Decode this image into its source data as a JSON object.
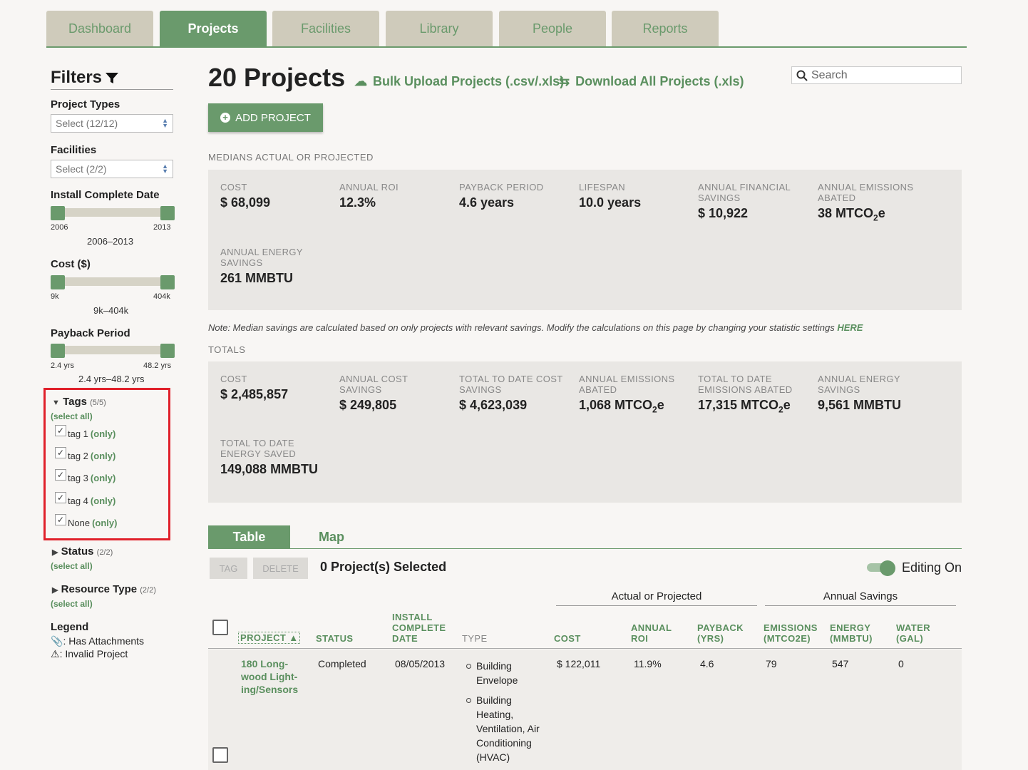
{
  "nav": {
    "tabs": [
      {
        "label": "Dashboard",
        "active": false
      },
      {
        "label": "Projects",
        "active": true
      },
      {
        "label": "Facilities",
        "active": false
      },
      {
        "label": "Library",
        "active": false
      },
      {
        "label": "People",
        "active": false
      },
      {
        "label": "Reports",
        "active": false
      }
    ]
  },
  "filters": {
    "title": "Filters",
    "project_types": {
      "label": "Project Types",
      "value": "Select (12/12)"
    },
    "facilities": {
      "label": "Facilities",
      "value": "Select (2/2)"
    },
    "install_date": {
      "label": "Install Complete Date",
      "min": "2006",
      "max": "2013",
      "range": "2006–2013"
    },
    "cost": {
      "label": "Cost ($)",
      "min": "9k",
      "max": "404k",
      "range": "9k–404k"
    },
    "payback": {
      "label": "Payback Period",
      "min": "2.4 yrs",
      "max": "48.2 yrs",
      "range": "2.4 yrs–48.2 yrs"
    },
    "tags": {
      "label": "Tags",
      "count": "(5/5)",
      "select_all": "(select all)",
      "items": [
        {
          "label": "tag 1",
          "only": "(only)",
          "checked": true
        },
        {
          "label": "tag 2",
          "only": "(only)",
          "checked": true
        },
        {
          "label": "tag 3",
          "only": "(only)",
          "checked": true
        },
        {
          "label": "tag 4",
          "only": "(only)",
          "checked": true
        },
        {
          "label": "None",
          "only": "(only)",
          "checked": true
        }
      ]
    },
    "status": {
      "label": "Status",
      "count": "(2/2)",
      "select_all": "(select all)"
    },
    "resource_type": {
      "label": "Resource Type",
      "count": "(2/2)",
      "select_all": "(select all)"
    },
    "legend": {
      "title": "Legend",
      "attachments": ": Has Attachments",
      "invalid": ": Invalid Project"
    }
  },
  "header": {
    "title": "20 Projects",
    "bulk_upload": "Bulk Upload Projects (.csv/.xls)",
    "download": "Download All Projects (.xls)",
    "search_placeholder": "Search",
    "add_project": "ADD PROJECT"
  },
  "medians": {
    "heading": "MEDIANS ACTUAL OR PROJECTED",
    "stats": [
      {
        "label": "COST",
        "value": "$ 68,099"
      },
      {
        "label": "ANNUAL ROI",
        "value": "12.3%"
      },
      {
        "label": "PAYBACK PERIOD",
        "value": "4.6 years"
      },
      {
        "label": "LIFESPAN",
        "value": "10.0 years"
      },
      {
        "label": "ANNUAL FINANCIAL SAVINGS",
        "value": "$ 10,922"
      },
      {
        "label": "ANNUAL EMISSIONS ABATED",
        "value": "38 MTCO",
        "sub": "2",
        "suffix": "e"
      },
      {
        "label": "ANNUAL ENERGY SAVINGS",
        "value": "261 MMBTU"
      }
    ],
    "note": "Note: Median savings are calculated based on only projects with relevant savings. Modify the calculations on this page by changing your statistic settings",
    "note_link": "HERE"
  },
  "totals": {
    "heading": "TOTALS",
    "stats": [
      {
        "label": "COST",
        "value": "$ 2,485,857"
      },
      {
        "label": "ANNUAL COST SAVINGS",
        "value": "$ 249,805"
      },
      {
        "label": "TOTAL TO DATE COST SAVINGS",
        "value": "$ 4,623,039"
      },
      {
        "label": "ANNUAL EMISSIONS ABATED",
        "value": "1,068 MTCO",
        "sub": "2",
        "suffix": "e"
      },
      {
        "label": "TOTAL TO DATE EMISSIONS ABATED",
        "value": "17,315 MTCO",
        "sub": "2",
        "suffix": "e"
      },
      {
        "label": "ANNUAL ENERGY SAVINGS",
        "value": "9,561 MMBTU"
      },
      {
        "label": "TOTAL TO DATE ENERGY SAVED",
        "value": "149,088 MMBTU"
      }
    ]
  },
  "view_tabs": {
    "table": "Table",
    "map": "Map"
  },
  "toolbar": {
    "tag": "TAG",
    "delete": "DELETE",
    "selected": "0 Project(s) Selected",
    "editing": "Editing On"
  },
  "table": {
    "group_actual": "Actual or Projected",
    "group_savings": "Annual Savings",
    "columns": {
      "project": "PROJECT ▲",
      "status": "STATUS",
      "install": "INSTALL COMPLETE DATE",
      "type": "TYPE",
      "cost": "COST",
      "roi": "ANNUAL ROI",
      "payback": "PAYBACK (YRS)",
      "emissions": "EMISSIONS (MTCO2E)",
      "energy": "ENERGY (MMBTU)",
      "water": "WATER (GAL)"
    },
    "rows": [
      {
        "project": "180 Long-wood Light-ing/Sensors",
        "status": "Completed",
        "install": "08/05/2013",
        "types": [
          "Building Envelope",
          "Building Heating, Ventilation, Air Conditioning (HVAC)"
        ],
        "cost": "$ 122,011",
        "roi": "11.9%",
        "payback": "4.6",
        "emissions": "79",
        "energy": "547",
        "water": "0"
      }
    ]
  }
}
